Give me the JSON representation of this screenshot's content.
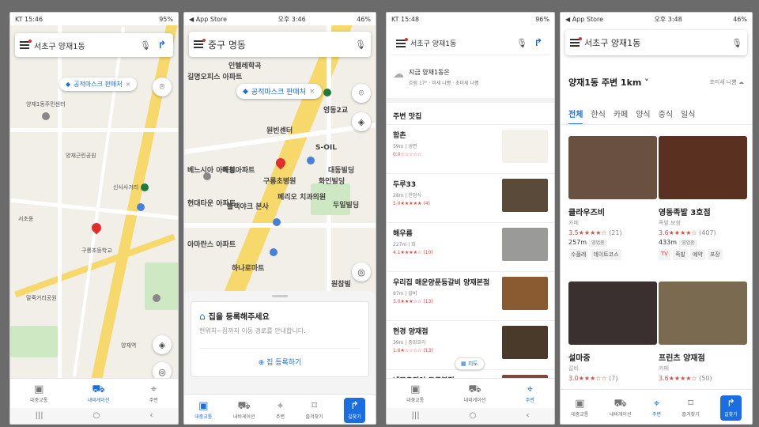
{
  "panel1": {
    "status": {
      "time": "KT 15:46",
      "right": "95%"
    },
    "search": {
      "text": "서초구 양재1동"
    },
    "chip": {
      "label": "공적마스크 판매처"
    },
    "pois": [
      "양재1동주민센터",
      "양재근린공원",
      "구룡초등학교",
      "말죽거리공원",
      "신사사거리",
      "서초동",
      "양재역"
    ],
    "tabs": [
      "대중교통",
      "내비게이션",
      "주변"
    ]
  },
  "panel2": {
    "status": {
      "left": "◀ App Store",
      "time": "오후 3:46",
      "right": "46%"
    },
    "search": {
      "text": "중구 명동"
    },
    "chip": {
      "label": "공적마스크 판매처"
    },
    "pois": [
      "길명오피스 아파트",
      "인텔레학곡",
      "원빈센터",
      "S-OIL",
      "영동2교",
      "구룡초병원",
      "페리오 치과의원",
      "베느시아 아파트",
      "현대타운 아파트",
      "블랙야크 본사",
      "아마란스 아파트",
      "하나로마트",
      "화인빌딩",
      "대동빌딩",
      "두일빌딩",
      "해청아파트",
      "원참빌"
    ],
    "card": {
      "title": "집을 등록해주세요",
      "desc": "현위치~집까지 이동 경로를 안내합니다.",
      "button": "집 등록하기"
    },
    "tabs": [
      "대중교통",
      "내비게이션",
      "주변",
      "즐겨찾기",
      "길찾기"
    ]
  },
  "panel3": {
    "status": {
      "time": "KT 15:48",
      "right": "96%"
    },
    "search": {
      "text": "서초구 양재1동"
    },
    "weather": {
      "line1": "지금 양재1동은",
      "line2": "흐림 17° · 미세 나쁨 · 초미세 나쁨"
    },
    "section": "주변 맛집",
    "items": [
      {
        "name": "함촌",
        "meta": "59m | 냉면",
        "stars": "0.0☆☆☆☆☆",
        "thumb": "#f4f1ea"
      },
      {
        "name": "두루33",
        "meta": "28m | 한정식",
        "stars": "5.0★★★★★ (4)",
        "thumb": "#5a4a3a"
      },
      {
        "name": "해우름",
        "meta": "227m | 회",
        "stars": "4.1★★★★☆ (10)",
        "thumb": "#9a9a98"
      },
      {
        "name": "우리집 매운양푼등갈비 양재본점",
        "meta": "87m | 갈비",
        "stars": "3.0★★★☆☆ (13)",
        "thumb": "#8a5a30"
      },
      {
        "name": "현경 양재점",
        "meta": "39m | 중화요리",
        "stars": "1.6★☆☆☆☆ (13)",
        "thumb": "#4a3a2a"
      },
      {
        "name": "네모오징어 도곡본점",
        "meta": "",
        "stars": "",
        "thumb": "#7a4a3a"
      }
    ],
    "map_button": "지도",
    "tabs": [
      "대중교통",
      "내비게이션",
      "주변"
    ]
  },
  "panel4": {
    "status": {
      "left": "◀ App Store",
      "time": "오후 3:48",
      "right": "46%"
    },
    "search": {
      "text": "서초구 양재1동"
    },
    "header": {
      "title": "양재1동 주변 1km",
      "air": "초미세 나쁨"
    },
    "categories": [
      "전체",
      "한식",
      "카페",
      "양식",
      "중식",
      "일식"
    ],
    "cards": [
      {
        "name": "클라우즈비",
        "type": "카페",
        "rating": "3.5★★★★☆",
        "count": "(21)",
        "dist": "257m",
        "status": "영업중",
        "tags": [
          "수플레",
          "데이트코스"
        ],
        "img": "#6a5040"
      },
      {
        "name": "영동족발 3호점",
        "type": "족발,보쌈",
        "rating": "3.6★★★★☆",
        "count": "(407)",
        "dist": "433m",
        "status": "영업중",
        "tags": [
          "TV",
          "족발",
          "예약",
          "포장"
        ],
        "img": "#5a3020"
      },
      {
        "name": "설마중",
        "type": "갈비",
        "rating": "3.0★★★☆☆",
        "count": "(7)",
        "dist": "",
        "status": "",
        "tags": [],
        "img": "#3a3030"
      },
      {
        "name": "프린츠 양재점",
        "type": "카페",
        "rating": "3.6★★★★☆",
        "count": "(50)",
        "dist": "",
        "status": "",
        "tags": [],
        "img": "#7a6a50"
      }
    ],
    "tabs": [
      "대중교통",
      "내비게이션",
      "주변",
      "즐겨찾기",
      "길찾기"
    ]
  }
}
